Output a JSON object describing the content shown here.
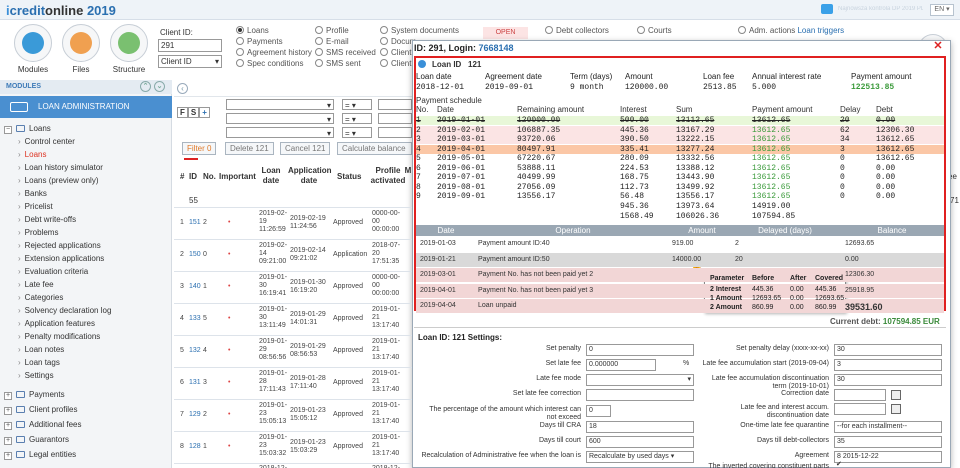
{
  "app": {
    "logo_left": "i",
    "logo_mid": "credit",
    "logo_right": "online",
    "year": "2019",
    "user_info": "Najnowsza kontrola  DP 2019 PDF 05 ZN",
    "lang": "EN ▾"
  },
  "modules": [
    {
      "label": "Modules",
      "icon": "modules-icon",
      "color": "#3a9ad8"
    },
    {
      "label": "Files",
      "icon": "files-icon",
      "color": "#f0a050"
    },
    {
      "label": "Structure",
      "icon": "structure-icon",
      "color": "#7ac070"
    }
  ],
  "client_search": {
    "label": "Client ID:",
    "value": "291",
    "select_value": "Client ID",
    "options_col1": [
      {
        "label": "Loans",
        "on": true
      },
      {
        "label": "Payments",
        "on": false
      },
      {
        "label": "Agreement history",
        "on": false
      },
      {
        "label": "Spec conditions",
        "on": false
      }
    ],
    "options_col2": [
      {
        "label": "Profile"
      },
      {
        "label": "E-mail"
      },
      {
        "label": "SMS received"
      },
      {
        "label": "SMS sent"
      }
    ],
    "options_col3": [
      {
        "label": "System documents"
      },
      {
        "label": "Docum"
      },
      {
        "label": "Client"
      },
      {
        "label": "Client"
      }
    ],
    "top_right": [
      {
        "label": "Debt collectors"
      },
      {
        "label": "Courts"
      },
      {
        "label": "Adm. actions"
      }
    ],
    "loan_triggers": "Loan triggers",
    "open_label": "OPEN"
  },
  "sidebar": {
    "header": "MODULES",
    "section": "LOAN ADMINISTRATION",
    "loans_label": "Loans",
    "items": [
      {
        "label": "Control center",
        "active": false
      },
      {
        "label": "Loans",
        "active": true
      },
      {
        "label": "Loan history simulator",
        "active": false
      },
      {
        "label": "Loans (preview only)",
        "active": false
      },
      {
        "label": "Banks",
        "active": false
      },
      {
        "label": "Pricelist",
        "active": false
      },
      {
        "label": "Debt write-offs",
        "active": false
      },
      {
        "label": "Problems",
        "active": false
      },
      {
        "label": "Rejected applications",
        "active": false
      },
      {
        "label": "Extension applications",
        "active": false
      },
      {
        "label": "Evaluation criteria",
        "active": false
      },
      {
        "label": "Late fee",
        "active": false
      },
      {
        "label": "Categories",
        "active": false
      },
      {
        "label": "Solvency declaration log",
        "active": false
      },
      {
        "label": "Application features",
        "active": false
      },
      {
        "label": "Penalty modifications",
        "active": false
      },
      {
        "label": "Loan notes",
        "active": false
      },
      {
        "label": "Loan tags",
        "active": false
      },
      {
        "label": "Settings",
        "active": false
      }
    ],
    "groups": [
      "Payments",
      "Client profiles",
      "Additional fees",
      "Guarantors",
      "Legal entities"
    ]
  },
  "toolbar": {
    "filter": "Filter 0",
    "delete": "Delete 121",
    "cancel": "Cancel 121",
    "calc": "Calculate balance",
    "fs_f": "F",
    "fs_s": "S",
    "plus": "+",
    "eq": "= ▾"
  },
  "table": {
    "headers": [
      "#",
      "ID",
      "No.",
      "Important",
      "Loan date",
      "Application date",
      "Status",
      "Profile activated",
      "M"
    ],
    "first_id": "55",
    "right_extra": "71",
    "right_ee": "ee",
    "rows": [
      {
        "n": "1",
        "id": "151",
        "no": "2",
        "loan": "2019-02-19 11:26:59",
        "app": "2019-02-19 11:24:56",
        "status": "Approved",
        "prof": "0000-00-00 00:00:00"
      },
      {
        "n": "2",
        "id": "150",
        "no": "0",
        "loan": "2019-02-14 09:21:00",
        "app": "2019-02-14 09:21:02",
        "status": "Application",
        "prof": "2018-07-20 17:51:35"
      },
      {
        "n": "3",
        "id": "140",
        "no": "1",
        "loan": "2019-01-30 16:19:41",
        "app": "2019-01-30 16:19:20",
        "status": "Approved",
        "prof": "0000-00-00 00:00:00"
      },
      {
        "n": "4",
        "id": "133",
        "no": "5",
        "loan": "2019-01-30 13:11:49",
        "app": "2019-01-29 14:01:31",
        "status": "Approved",
        "prof": "2019-01-21 13:17:40"
      },
      {
        "n": "5",
        "id": "132",
        "no": "4",
        "loan": "2019-01-29 08:56:56",
        "app": "2019-01-29 08:56:53",
        "status": "Approved",
        "prof": "2019-01-21 13:17:40"
      },
      {
        "n": "6",
        "id": "131",
        "no": "3",
        "loan": "2019-01-28 17:11:43",
        "app": "2019-01-28 17:11:40",
        "status": "Approved",
        "prof": "2019-01-21 13:17:40"
      },
      {
        "n": "7",
        "id": "129",
        "no": "2",
        "loan": "2019-01-23 15:05:13",
        "app": "2019-01-23 15:05:12",
        "status": "Approved",
        "prof": "2019-01-21 13:17:40"
      },
      {
        "n": "8",
        "id": "128",
        "no": "1",
        "loan": "2019-01-23 15:03:32",
        "app": "2019-01-23 15:03:29",
        "status": "Approved",
        "prof": "2019-01-21 13:17:40"
      }
    ],
    "last_row_loan": "2018-12-",
    "last_row_prof": "2018-12-"
  },
  "modal": {
    "title_prefix": "ID: 291, Login: ",
    "login": "7668148",
    "close": "✕",
    "loan_id_label": "Loan ID",
    "loan_id": "121",
    "summary_headers": [
      "Loan date",
      "Agreement date",
      "Term (days)",
      "Amount",
      "Loan fee",
      "Annual interest rate",
      "Payment amount"
    ],
    "summary_values": [
      "2018-12-01",
      "2019-09-01",
      "9 month",
      "120000.00",
      "2513.85",
      "5.000",
      "122513.85"
    ],
    "schedule_title": "Payment schedule",
    "schedule_headers": [
      "No.",
      "Date",
      "Remaining amount",
      "Interest",
      "Sum",
      "Payment amount",
      "Delay",
      "Debt"
    ],
    "schedule": [
      {
        "no": "1",
        "date": "2019-01-01",
        "rem": "120000.00",
        "int": "500.00",
        "sum": "13112.65",
        "pay": "13612.65",
        "delay": "20",
        "debt": "0.00",
        "bg": "#e8f7d8",
        "strike": true
      },
      {
        "no": "2",
        "date": "2019-02-01",
        "rem": "106887.35",
        "int": "445.36",
        "sum": "13167.29",
        "pay": "13612.65",
        "delay": "62",
        "debt": "12306.30",
        "bg": "#fbe4e4",
        "strike": false
      },
      {
        "no": "3",
        "date": "2019-03-01",
        "rem": "93720.06",
        "int": "390.50",
        "sum": "13222.15",
        "pay": "13612.65",
        "delay": "34",
        "debt": "13612.65",
        "bg": "#fbe4e4",
        "strike": false
      },
      {
        "no": "4",
        "date": "2019-04-01",
        "rem": "80497.91",
        "int": "335.41",
        "sum": "13277.24",
        "pay": "13612.65",
        "delay": "3",
        "debt": "13612.65",
        "bg": "#fbc7a6",
        "strike": false
      },
      {
        "no": "5",
        "date": "2019-05-01",
        "rem": "67220.67",
        "int": "280.09",
        "sum": "13332.56",
        "pay": "13612.65",
        "delay": "0",
        "debt": "13612.65",
        "bg": "#ffffff",
        "strike": false
      },
      {
        "no": "6",
        "date": "2019-06-01",
        "rem": "53888.11",
        "int": "224.53",
        "sum": "13388.12",
        "pay": "13612.65",
        "delay": "0",
        "debt": "0.00",
        "bg": "#ffffff",
        "strike": false
      },
      {
        "no": "7",
        "date": "2019-07-01",
        "rem": "40499.99",
        "int": "168.75",
        "sum": "13443.90",
        "pay": "13612.65",
        "delay": "0",
        "debt": "0.00",
        "bg": "#ffffff",
        "strike": false
      },
      {
        "no": "8",
        "date": "2019-08-01",
        "rem": "27056.09",
        "int": "112.73",
        "sum": "13499.92",
        "pay": "13612.65",
        "delay": "0",
        "debt": "0.00",
        "bg": "#ffffff",
        "strike": false
      },
      {
        "no": "9",
        "date": "2019-09-01",
        "rem": "13556.17",
        "int": "56.48",
        "sum": "13556.17",
        "pay": "13612.65",
        "delay": "0",
        "debt": "0.00",
        "bg": "#ffffff",
        "strike": false
      }
    ],
    "totals1": [
      "945.36",
      "13973.64",
      "14919.00"
    ],
    "totals2": [
      "1568.49",
      "106026.36",
      "107594.85"
    ],
    "ops_headers": [
      "Date",
      "Operation",
      "Amount",
      "Delayed (days)",
      "Balance"
    ],
    "ops": [
      {
        "date": "2019-01-03",
        "op": "Payment amount ID:40",
        "amt": "919.00",
        "del": "2",
        "bal": "12693.65",
        "bg": "#ffffff"
      },
      {
        "date": "2019-01-21",
        "op": "Payment amount ID:50",
        "amt": "14000.00",
        "del": "20",
        "bal": "0.00",
        "bg": "#d9d9d9"
      },
      {
        "date": "2019-03-01",
        "op": "Payment No. has not been paid yet 2",
        "amt": "",
        "del": "",
        "bal": "12306.30",
        "bg": "#f2d6d6"
      },
      {
        "date": "2019-04-01",
        "op": "Payment No. has not been paid yet 3",
        "amt": "",
        "del": "",
        "bal": "25918.95",
        "bg": "#f2d6d6"
      },
      {
        "date": "2019-04-04",
        "op": "Loan unpaid",
        "amt": "",
        "del": "",
        "bal": "39531.60",
        "bg": "#f2d6d6"
      }
    ],
    "tooltip": {
      "headers": [
        "Parameter",
        "Before",
        "After",
        "Covered"
      ],
      "rows": [
        [
          "2 Interest",
          "445.36",
          "0.00",
          "445.36"
        ],
        [
          "1 Amount",
          "12693.65",
          "0.00",
          "12693.65"
        ],
        [
          "2 Amount",
          "860.99",
          "0.00",
          "860.99"
        ]
      ]
    },
    "current_debt_label": "Current debt: ",
    "current_debt": "107594.85 EUR",
    "settings_title": "Loan ID: 121 Settings:",
    "settings_left": [
      {
        "label": "Set penalty",
        "value": "0"
      },
      {
        "label": "Set late fee",
        "value": "0.000000",
        "suffix": "%"
      },
      {
        "label": "Late fee mode",
        "value": ""
      },
      {
        "label": "Set late fee correction",
        "value": ""
      },
      {
        "label": "The percentage of the amount which interest can not exceed",
        "value": "0"
      },
      {
        "label": "Days till CRA",
        "value": "18"
      },
      {
        "label": "Days till court",
        "value": "600"
      },
      {
        "label": "Recalculation of Administrative fee when the loan is",
        "value": "Recalculate by used days ▾"
      }
    ],
    "settings_right": [
      {
        "label": "Set penalty delay (xxxx-xx-xx)",
        "value": "30"
      },
      {
        "label": "Late fee accumulation start (2019-09-04)",
        "value": "3"
      },
      {
        "label": "Late fee accumulation discontinuation term (2019-10-01)",
        "value": "30"
      },
      {
        "label": "Correction date",
        "value": ""
      },
      {
        "label": "Late fee and interest accum. discontinuation date",
        "value": ""
      },
      {
        "label": "One-time late fee quarantine",
        "value": "--for each installment--"
      },
      {
        "label": "Days till debt-collectors",
        "value": "35"
      },
      {
        "label": "Agreement",
        "value": "8 2015-12-22"
      },
      {
        "label": "The inverted covering constituent parts",
        "value": ""
      }
    ]
  }
}
